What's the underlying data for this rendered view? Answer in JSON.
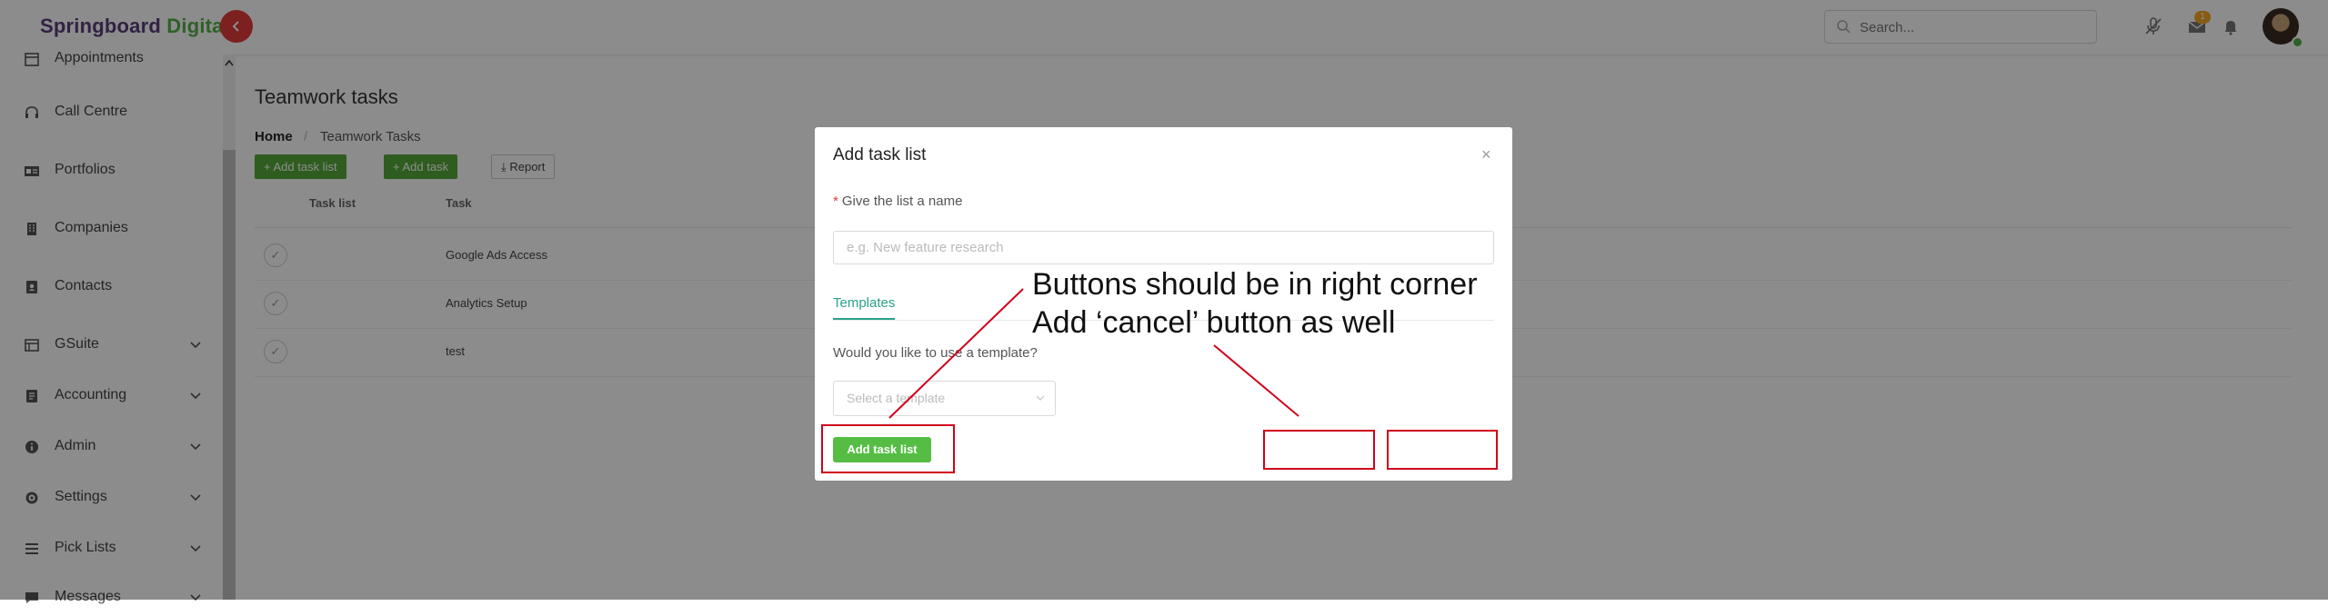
{
  "header": {
    "brand_part1": "Springboard",
    "brand_part2": "Digital",
    "search_placeholder": "Search...",
    "notification_count": "1"
  },
  "sidebar": {
    "items": [
      {
        "label": "Appointments",
        "icon": "calendar-icon",
        "has_chevron": false
      },
      {
        "label": "Call Centre",
        "icon": "headset-icon",
        "has_chevron": false
      },
      {
        "label": "Portfolios",
        "icon": "id-card-icon",
        "has_chevron": false
      },
      {
        "label": "Companies",
        "icon": "building-icon",
        "has_chevron": false
      },
      {
        "label": "Contacts",
        "icon": "contact-book-icon",
        "has_chevron": false
      },
      {
        "label": "GSuite",
        "icon": "grid-icon",
        "has_chevron": true
      },
      {
        "label": "Accounting",
        "icon": "ledger-icon",
        "has_chevron": true
      },
      {
        "label": "Admin",
        "icon": "info-icon",
        "has_chevron": true
      },
      {
        "label": "Settings",
        "icon": "gear-icon",
        "has_chevron": true
      },
      {
        "label": "Pick Lists",
        "icon": "list-icon",
        "has_chevron": true
      },
      {
        "label": "Messages",
        "icon": "message-icon",
        "has_chevron": true
      }
    ]
  },
  "main": {
    "title": "Teamwork tasks",
    "breadcrumb": {
      "home": "Home",
      "separator": "/",
      "current": "Teamwork Tasks"
    },
    "buttons": {
      "add_task_list": "+ Add task list",
      "add_task": "+ Add task",
      "report": "⤓ Report"
    },
    "table": {
      "columns": [
        "Task list",
        "Task"
      ],
      "rows": [
        {
          "task": "Google Ads Access"
        },
        {
          "task": "Analytics Setup"
        },
        {
          "task": "test"
        }
      ]
    }
  },
  "modal": {
    "title": "Add task list",
    "close": "×",
    "name_label": "Give the list a name",
    "name_required_mark": "*",
    "name_placeholder": "e.g. New feature research",
    "tab_templates": "Templates",
    "template_question": "Would you like to use a template?",
    "template_placeholder": "Select a template",
    "submit": "Add task list"
  },
  "annotations": {
    "line1": "Buttons should be in right corner",
    "line2": "Add ‘cancel’ button as well",
    "color": "#d0021b"
  },
  "colors": {
    "brand_purple": "#5a3d7a",
    "brand_green": "#57b04a",
    "accent_teal": "#2aa38a",
    "button_green": "#55bd43",
    "danger_red": "#e23b3b"
  }
}
